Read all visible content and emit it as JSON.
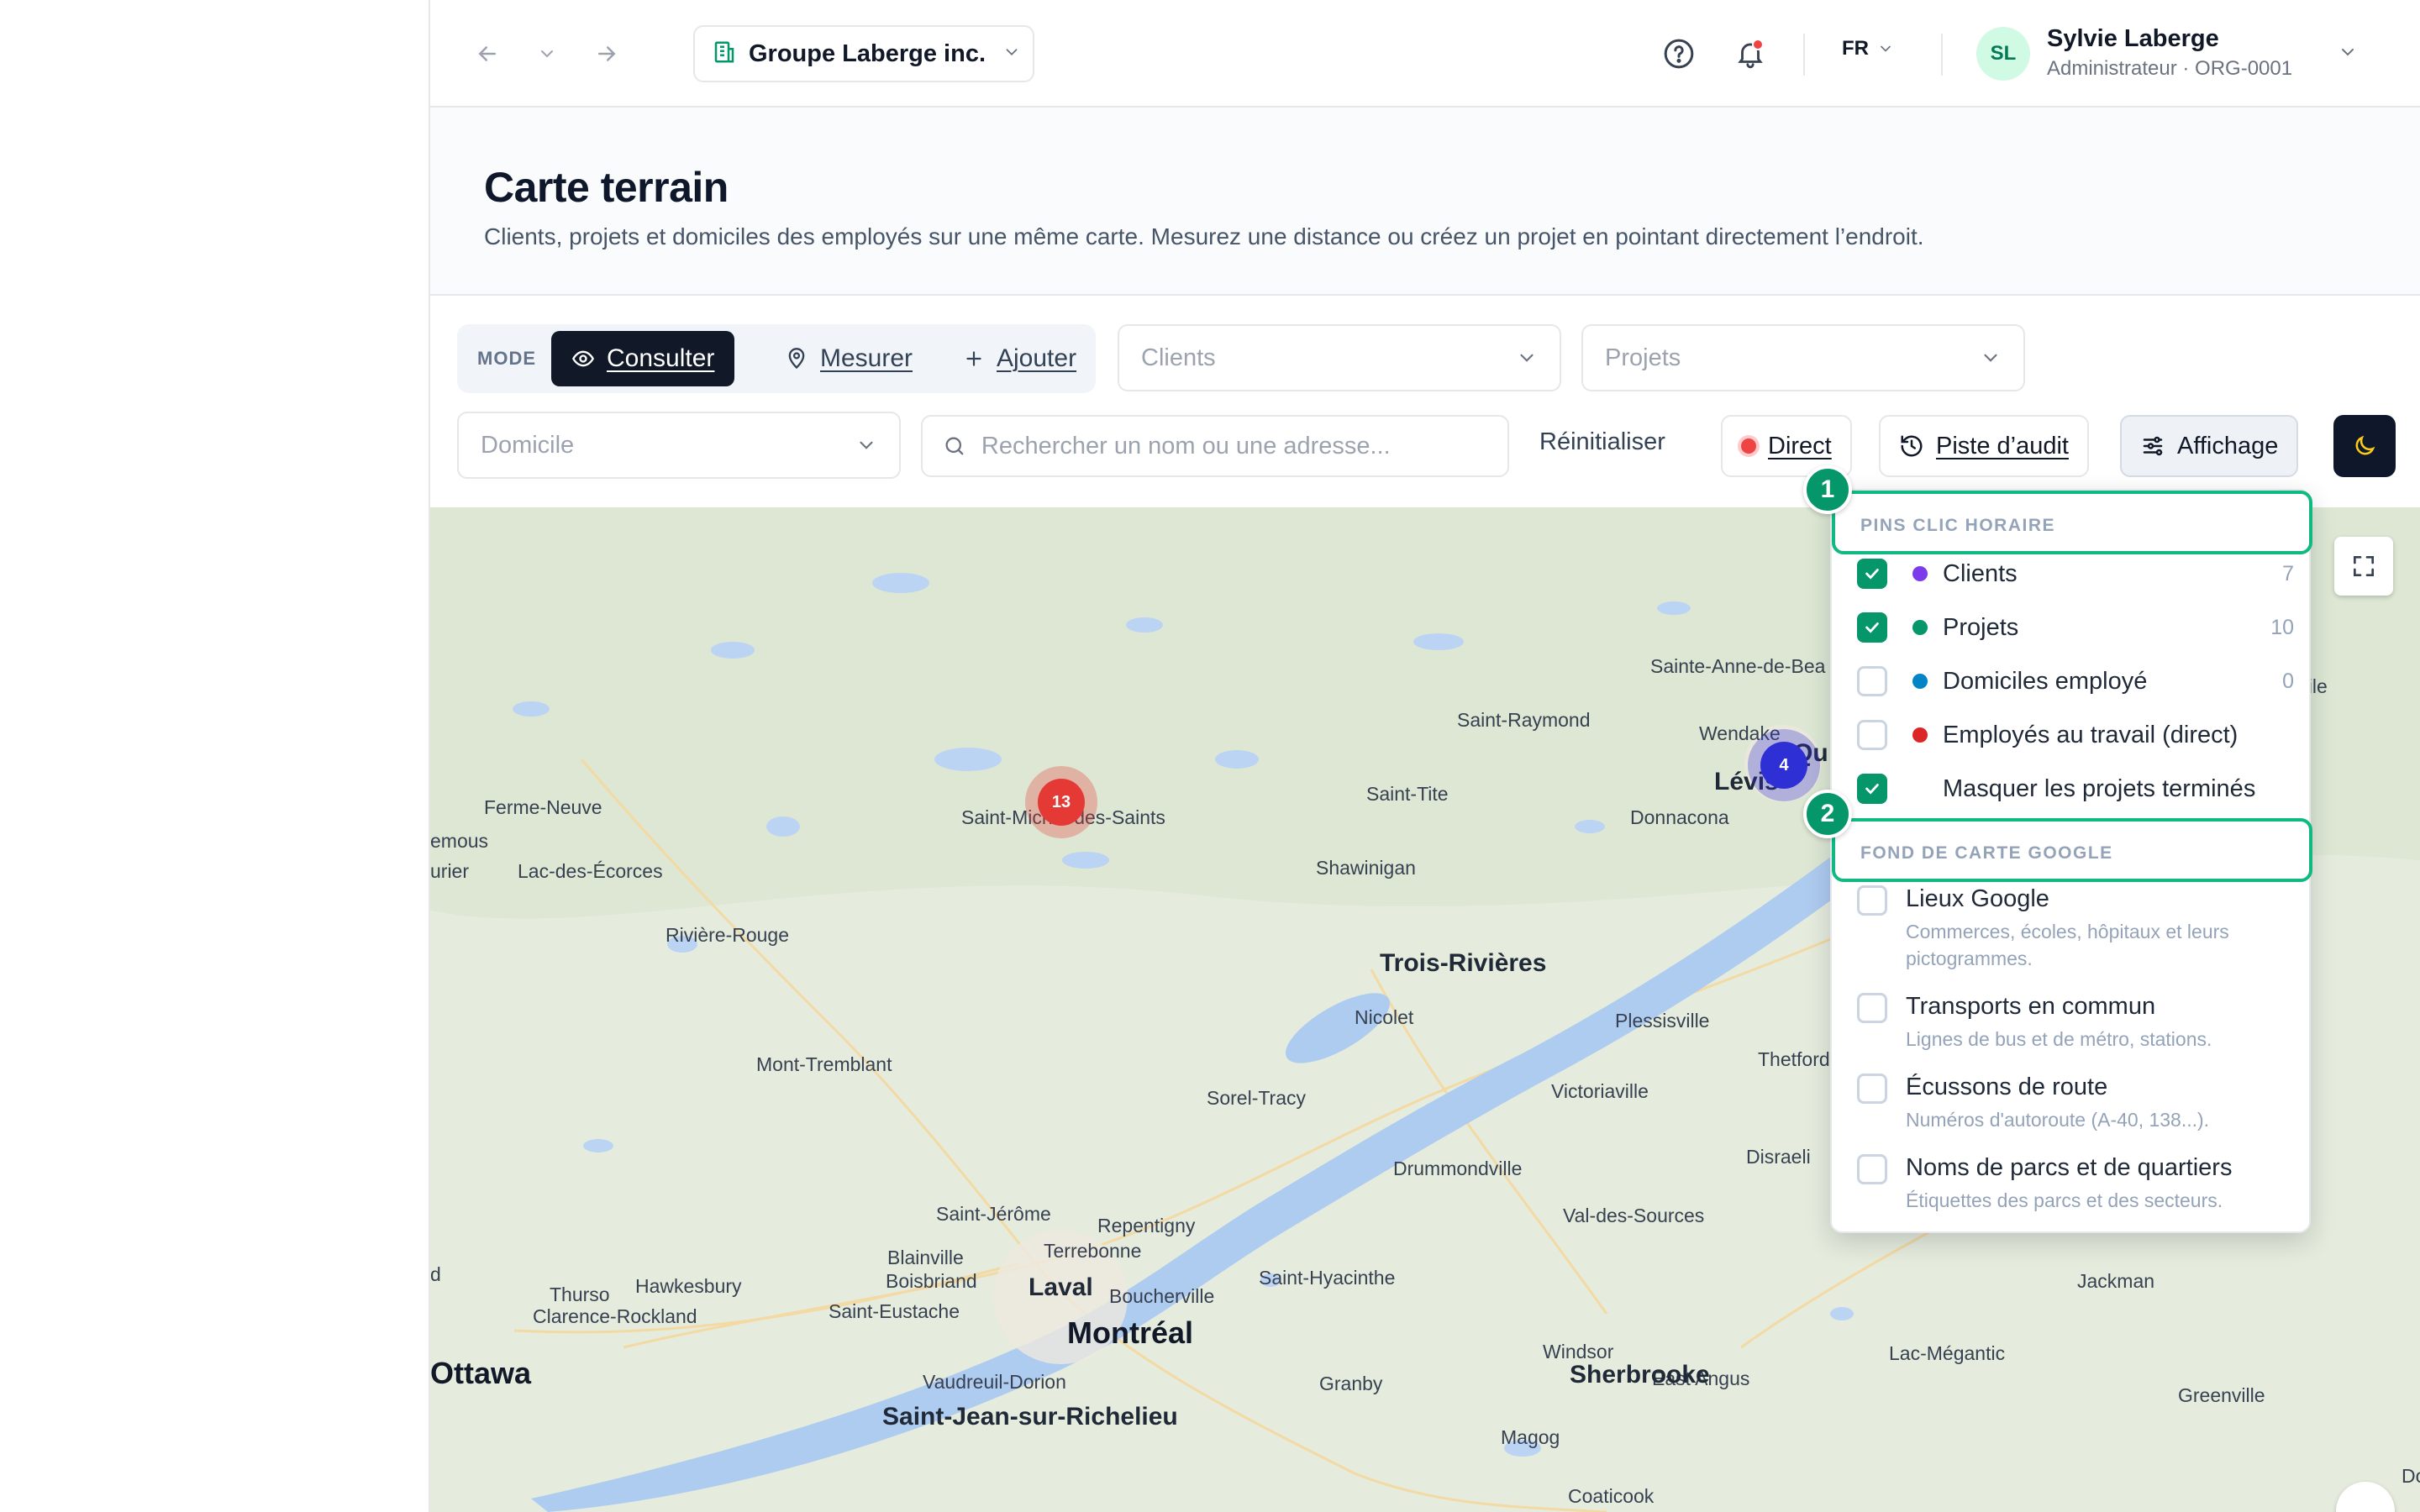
{
  "topbar": {
    "org_name": "Groupe Laberge inc.",
    "language": "FR",
    "user_initials": "SL",
    "user_name": "Sylvie Laberge",
    "user_role": "Administrateur · ORG-0001"
  },
  "header": {
    "title": "Carte terrain",
    "subtitle": "Clients, projets et domiciles des employés sur une même carte. Mesurez une distance ou créez un projet en pointant directement l’endroit."
  },
  "toolbar": {
    "mode_label": "MODE",
    "modes": [
      {
        "label": "Consulter",
        "icon": "eye-icon",
        "active": true
      },
      {
        "label": "Mesurer",
        "icon": "pin-icon",
        "active": false
      },
      {
        "label": "Ajouter",
        "icon": "plus-icon",
        "active": false
      }
    ],
    "clients_select": "Clients",
    "projects_select": "Projets",
    "home_select": "Domicile",
    "search_placeholder": "Rechercher un nom ou une adresse...",
    "reset_label": "Réinitialiser",
    "live_label": "Direct",
    "audit_label": "Piste d’audit",
    "display_label": "Affichage"
  },
  "map": {
    "cities": [
      {
        "name": "Sainte-Anne-de-Bea",
        "cls": ""
      },
      {
        "name": "Saint-Raymond",
        "cls": ""
      },
      {
        "name": "Wendake",
        "cls": ""
      },
      {
        "name": "Lévis",
        "cls": "big"
      },
      {
        "name": "Qu",
        "cls": "big"
      },
      {
        "name": "Ferme-Neuve",
        "cls": ""
      },
      {
        "name": "Saint-Michel-des-Saints",
        "cls": ""
      },
      {
        "name": "Saint-Tite",
        "cls": ""
      },
      {
        "name": "Donnacona",
        "cls": ""
      },
      {
        "name": "emous",
        "cls": ""
      },
      {
        "name": "urier",
        "cls": ""
      },
      {
        "name": "Lac-des-Écorces",
        "cls": ""
      },
      {
        "name": "Shawinigan",
        "cls": ""
      },
      {
        "name": "Rivière-Rouge",
        "cls": ""
      },
      {
        "name": "Trois-Rivières",
        "cls": "big"
      },
      {
        "name": "Nicolet",
        "cls": ""
      },
      {
        "name": "Plessisville",
        "cls": ""
      },
      {
        "name": "Mont-Tremblant",
        "cls": ""
      },
      {
        "name": "Thetford Mines",
        "cls": ""
      },
      {
        "name": "Sorel-Tracy",
        "cls": ""
      },
      {
        "name": "Victoriaville",
        "cls": ""
      },
      {
        "name": "Disraeli",
        "cls": ""
      },
      {
        "name": "Drummondville",
        "cls": ""
      },
      {
        "name": "Saint-Jérôme",
        "cls": ""
      },
      {
        "name": "Repentigny",
        "cls": ""
      },
      {
        "name": "Val-des-Sources",
        "cls": ""
      },
      {
        "name": "Terrebonne",
        "cls": ""
      },
      {
        "name": "Blainville",
        "cls": ""
      },
      {
        "name": "Boisbriand",
        "cls": ""
      },
      {
        "name": "Laval",
        "cls": "big"
      },
      {
        "name": "Boucherville",
        "cls": ""
      },
      {
        "name": "Saint-Hyacinthe",
        "cls": ""
      },
      {
        "name": "Jackman",
        "cls": ""
      },
      {
        "name": "Thurso",
        "cls": ""
      },
      {
        "name": "Hawkesbury",
        "cls": ""
      },
      {
        "name": "Clarence-Rockland",
        "cls": ""
      },
      {
        "name": "Saint-Eustache",
        "cls": ""
      },
      {
        "name": "Montréal",
        "cls": "huge"
      },
      {
        "name": "Windsor",
        "cls": ""
      },
      {
        "name": "Lac-Mégantic",
        "cls": ""
      },
      {
        "name": "East Angus",
        "cls": ""
      },
      {
        "name": "Ottawa",
        "cls": "huge"
      },
      {
        "name": "Vaudreuil-Dorion",
        "cls": ""
      },
      {
        "name": "Granby",
        "cls": ""
      },
      {
        "name": "Sherbrooke",
        "cls": "big"
      },
      {
        "name": "Greenville",
        "cls": ""
      },
      {
        "name": "Saint-Jean-sur-Richelieu",
        "cls": "big"
      },
      {
        "name": "Magog",
        "cls": ""
      },
      {
        "name": "Coaticook",
        "cls": ""
      },
      {
        "name": "mphile",
        "cls": ""
      },
      {
        "name": "d",
        "cls": ""
      },
      {
        "name": "Do",
        "cls": ""
      }
    ],
    "clusters": [
      {
        "label": "4",
        "color": "#2f2fd6"
      },
      {
        "label": "13",
        "color": "#e53935"
      }
    ]
  },
  "panel": {
    "step1": "1",
    "step2": "2",
    "pins_header": "PINS CLIC HORAIRE",
    "pins": [
      {
        "label": "Clients",
        "count": "7",
        "color": "#7c3aed",
        "checked": true
      },
      {
        "label": "Projets",
        "count": "10",
        "color": "#059669",
        "checked": true
      },
      {
        "label": "Domiciles employé",
        "count": "0",
        "color": "#0284c7",
        "checked": false
      },
      {
        "label": "Employés au travail (direct)",
        "count": "",
        "color": "#dc2626",
        "checked": false
      },
      {
        "label": "Masquer les projets terminés",
        "count": "",
        "color": "",
        "checked": true
      }
    ],
    "base_header": "FOND DE CARTE GOOGLE",
    "base_options": [
      {
        "title": "Lieux Google",
        "desc": "Commerces, écoles, hôpitaux et leurs pictogrammes."
      },
      {
        "title": "Transports en commun",
        "desc": "Lignes de bus et de métro, stations."
      },
      {
        "title": "Écussons de route",
        "desc": "Numéros d'autoroute (A-40, 138...)."
      },
      {
        "title": "Noms de parcs et de quartiers",
        "desc": "Étiquettes des parcs et des secteurs."
      }
    ]
  }
}
